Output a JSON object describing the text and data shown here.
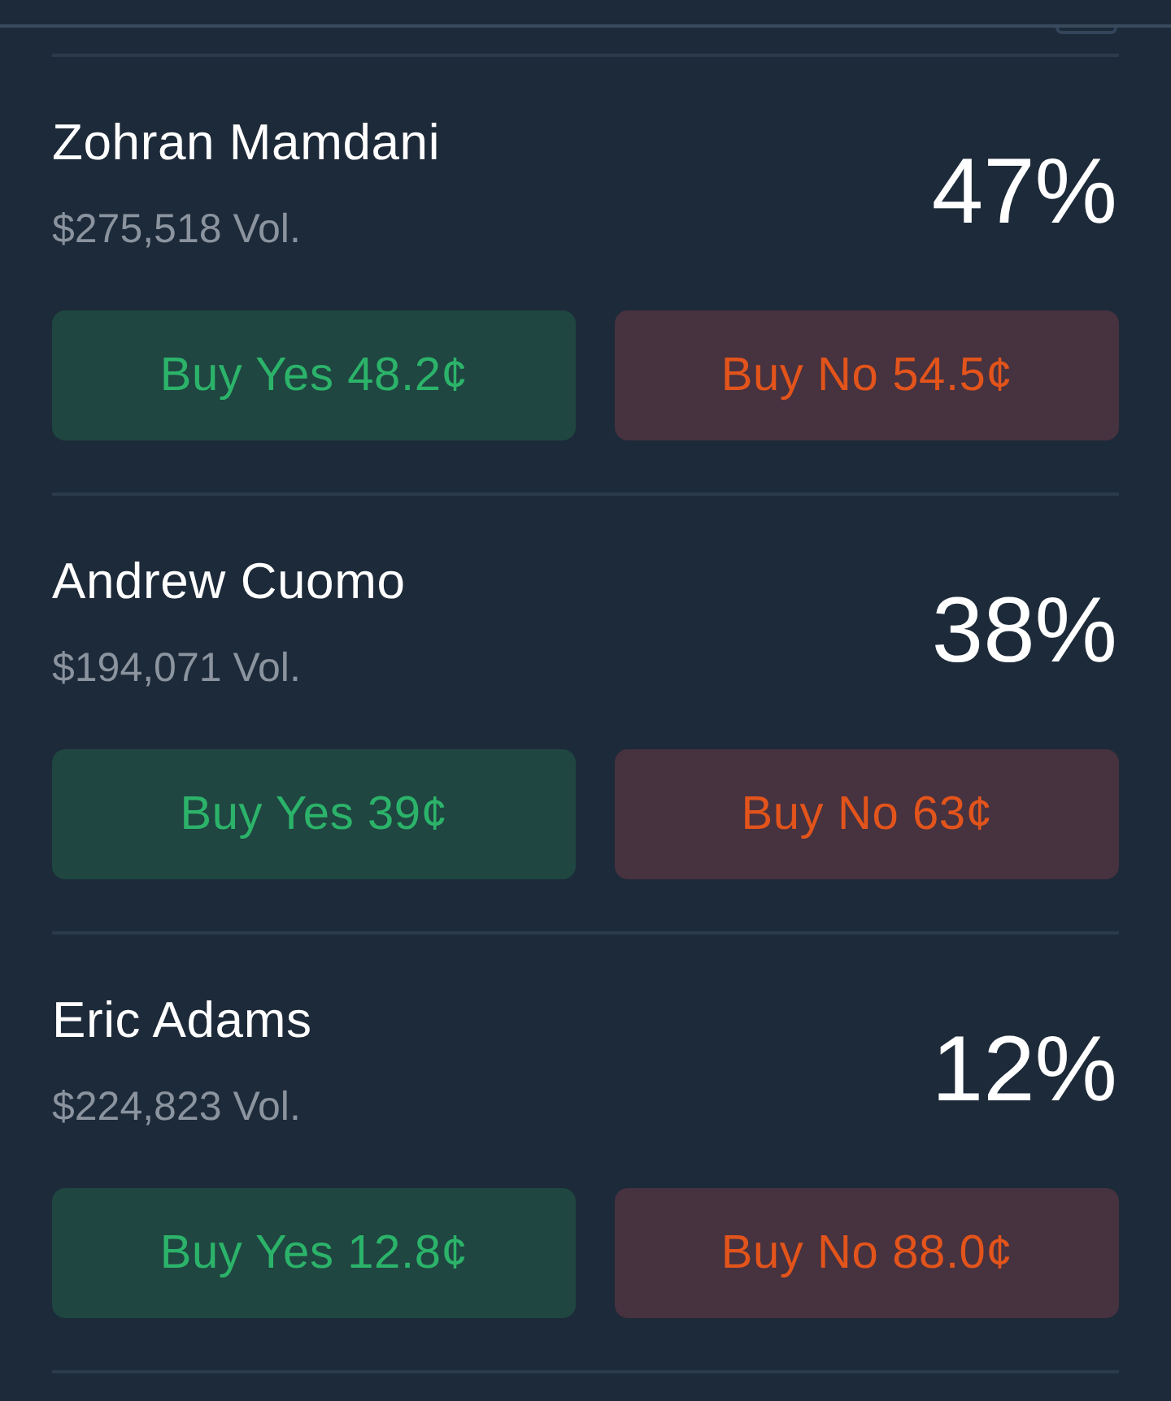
{
  "markets": [
    {
      "name": "Zohran Mamdani",
      "volume": "$275,518 Vol.",
      "chance": "47%",
      "buttons": [
        {
          "kind": "yes",
          "label": "Buy Yes 48.2¢"
        },
        {
          "kind": "no",
          "label": "Buy No 54.5¢"
        }
      ]
    },
    {
      "name": "Andrew Cuomo",
      "volume": "$194,071 Vol.",
      "chance": "38%",
      "buttons": [
        {
          "kind": "yes",
          "label": "Buy Yes 39¢"
        },
        {
          "kind": "no",
          "label": "Buy No 63¢"
        }
      ]
    },
    {
      "name": "Eric Adams",
      "volume": "$224,823 Vol.",
      "chance": "12%",
      "buttons": [
        {
          "kind": "yes",
          "label": "Buy Yes 12.8¢"
        },
        {
          "kind": "no",
          "label": "Buy No 88.0¢"
        }
      ]
    }
  ]
}
